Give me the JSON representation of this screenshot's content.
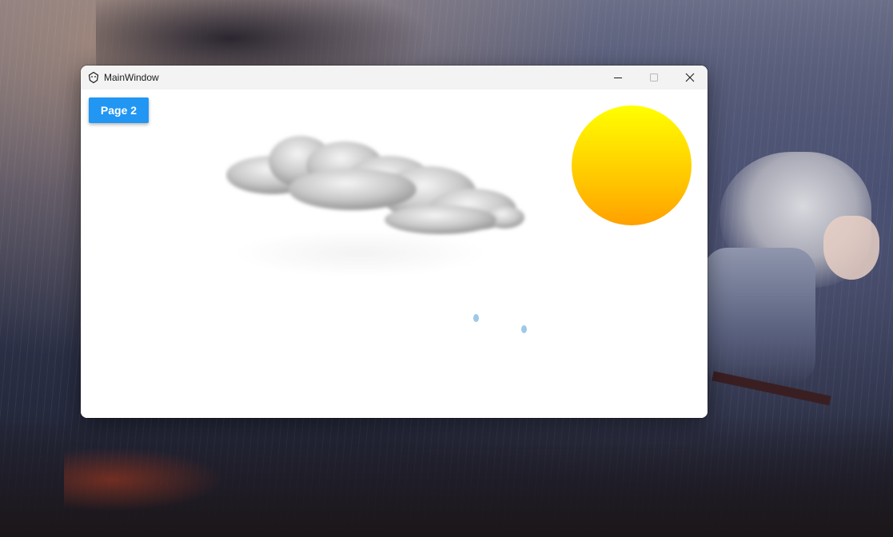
{
  "window": {
    "title": "MainWindow",
    "icon": "app-icon",
    "caption_buttons": [
      "minimize-icon",
      "maximize-icon",
      "close-icon"
    ]
  },
  "content": {
    "page_button_label": "Page 2",
    "colors": {
      "button": "#2196f3",
      "sun_top": "#ffff00",
      "sun_bottom": "#ffa000",
      "raindrop": "#9ec9e6"
    }
  }
}
